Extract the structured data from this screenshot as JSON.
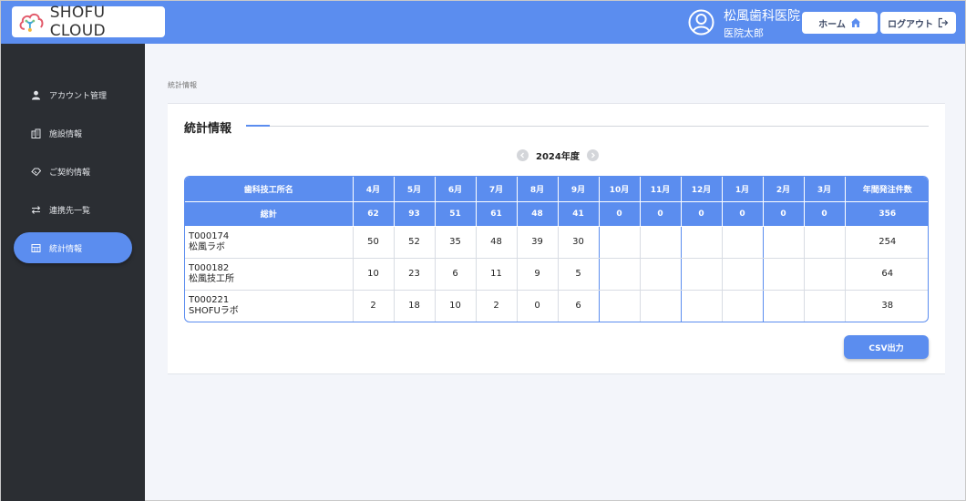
{
  "header": {
    "logo_text": "SHOFU CLOUD",
    "clinic_name": "松風歯科医院",
    "user_name": "医院太郎",
    "home_label": "ホーム",
    "logout_label": "ログアウト",
    "accent_color": "#5b8def"
  },
  "sidebar": {
    "items": [
      {
        "label": "アカウント管理",
        "icon": "user-icon"
      },
      {
        "label": "施設情報",
        "icon": "building-icon"
      },
      {
        "label": "ご契約情報",
        "icon": "contract-icon"
      },
      {
        "label": "連携先一覧",
        "icon": "swap-icon"
      },
      {
        "label": "統計情報",
        "icon": "stats-icon",
        "active": true
      }
    ]
  },
  "breadcrumb": "統計情報",
  "card": {
    "title": "統計情報",
    "year": "2024年度",
    "csv_label": "CSV出力"
  },
  "table": {
    "head_lab": "歯科技工所名",
    "months": [
      "4月",
      "5月",
      "6月",
      "7月",
      "8月",
      "9月",
      "10月",
      "11月",
      "12月",
      "1月",
      "2月",
      "3月"
    ],
    "annual_label": "年間発注件数",
    "total_label": "総計",
    "totals": [
      "62",
      "93",
      "51",
      "61",
      "48",
      "41",
      "0",
      "0",
      "0",
      "0",
      "0",
      "0"
    ],
    "annual_total": "356",
    "rows": [
      {
        "code": "T000174",
        "name": "松風ラボ",
        "values": [
          "50",
          "52",
          "35",
          "48",
          "39",
          "30",
          "",
          "",
          "",
          "",
          "",
          ""
        ],
        "annual": "254"
      },
      {
        "code": "T000182",
        "name": "松風技工所",
        "values": [
          "10",
          "23",
          "6",
          "11",
          "9",
          "5",
          "",
          "",
          "",
          "",
          "",
          ""
        ],
        "annual": "64"
      },
      {
        "code": "T000221",
        "name": "SHOFUラボ",
        "values": [
          "2",
          "18",
          "10",
          "2",
          "0",
          "6",
          "",
          "",
          "",
          "",
          "",
          ""
        ],
        "annual": "38"
      }
    ]
  }
}
